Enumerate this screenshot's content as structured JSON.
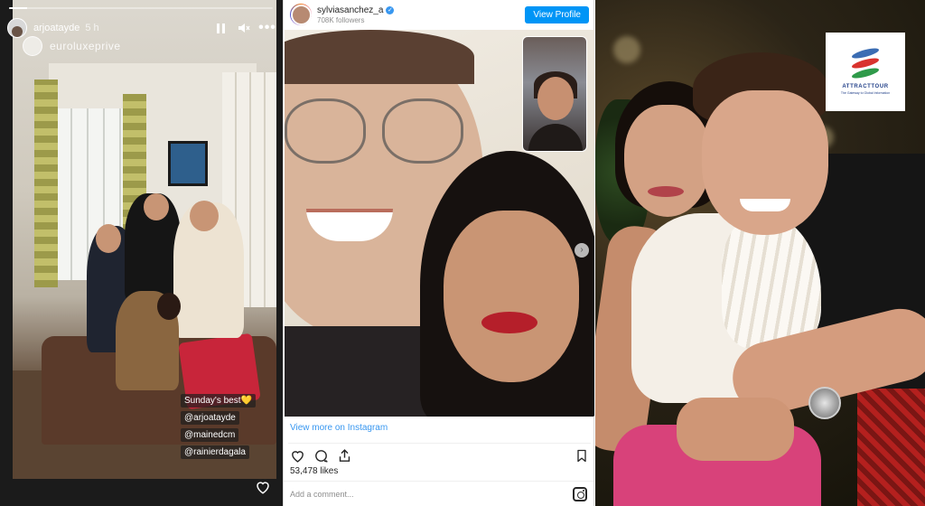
{
  "story": {
    "username": "arjoatayde",
    "time": "5 h",
    "progress": 0.07,
    "watermark": "euroluxeprive",
    "caption": "Sunday's best",
    "caption_emoji": "💛",
    "mentions": [
      "@arjoatayde",
      "@mainedcm",
      "@rainierdagala"
    ],
    "icons": {
      "pause": "pause-icon",
      "sound": "speaker-icon",
      "more": "more-icon",
      "like": "heart-icon"
    }
  },
  "instagram": {
    "username": "sylviasanchez_a",
    "followers": "708K followers",
    "view_profile": "View Profile",
    "view_more": "View more on Instagram",
    "likes": "53,478 likes",
    "comment_placeholder": "Add a comment...",
    "carousel_pages": 2,
    "carousel_active": 1,
    "icons": {
      "like": "heart-icon",
      "comment": "comment-icon",
      "share": "share-icon",
      "save": "bookmark-icon",
      "logo": "instagram-icon",
      "next": "chevron-right-icon"
    }
  },
  "brand": {
    "name": "ATTRACTTOUR",
    "tagline": "The Gateway to Global Information"
  },
  "colors": {
    "ig_blue": "#0095f6",
    "link_blue": "#3897f0",
    "story_bg": "#1b1b1b"
  }
}
